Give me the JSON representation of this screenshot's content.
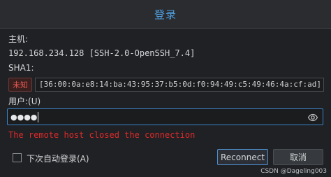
{
  "dialog": {
    "title": "登录"
  },
  "host": {
    "label": "主机:",
    "value": "192.168.234.128 [SSH-2.0-OpenSSH_7.4]"
  },
  "sha": {
    "label": "SHA1:",
    "badge": "未知",
    "fingerprint": "[36:00:0a:e8:14:ba:43:95:37:b5:0d:f0:94:49:c5:49:46:4a:cf:ad]"
  },
  "user": {
    "label": "用户:(U)",
    "password_mask": "●●●●",
    "eye_icon": "eye-icon"
  },
  "error": {
    "message": "The remote host closed the connection",
    "color": "#e02a2a"
  },
  "footer": {
    "auto_login_label": "下次自动登录(A)",
    "auto_login_checked": false,
    "reconnect_label": "Reconnect",
    "cancel_label": "取消",
    "watermark": "CSDN @Dageling003"
  },
  "colors": {
    "accent": "#4f9fe0",
    "focus_border": "#3a84c9",
    "error": "#e02a2a",
    "badge_text": "#e85a4f"
  }
}
